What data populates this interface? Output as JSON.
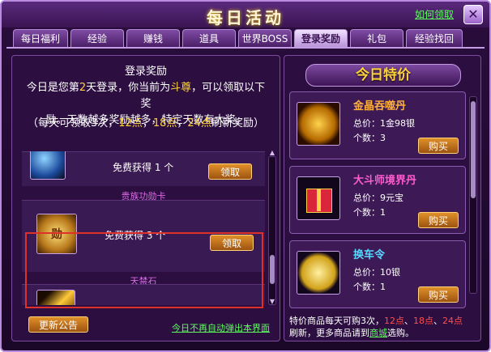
{
  "window": {
    "title": "每日活动",
    "help_link": "如何领取",
    "close_icon": "close-icon"
  },
  "tabs": [
    {
      "label": "每日福利"
    },
    {
      "label": "经验"
    },
    {
      "label": "赚钱"
    },
    {
      "label": "道具"
    },
    {
      "label": "世界BOSS"
    },
    {
      "label": "登录奖励"
    },
    {
      "label": "礼包"
    },
    {
      "label": "经验找回"
    }
  ],
  "active_tab": "登录奖励",
  "login": {
    "heading": "登录奖励",
    "desc_a": "今日是您第",
    "day": "2",
    "desc_b": "天登录，你当前为",
    "rank": "斗尊",
    "desc_c": "，可以领取以下奖",
    "desc_d": "励。天数越多奖励越多，特定天数有大奖。",
    "times_a": "（每天可领取3次，",
    "t1": "12点",
    "sep1": "，",
    "t2": "18点",
    "sep2": "，",
    "t3": "24点",
    "times_b": "刷新奖励）",
    "rewards": [
      {
        "free_text": "免费获得 1 个",
        "button": "领取"
      },
      {
        "section": "贵族功勋卡",
        "free_text": "免费获得 3 个",
        "button": "领取",
        "icon_text": "勋"
      },
      {
        "section": "天禁石"
      }
    ],
    "notice_button": "更新公告",
    "no_popup_link": "今日不再自动弹出本界面"
  },
  "shop": {
    "title": "今日特价",
    "items": [
      {
        "name": "金晶吞噬丹",
        "name_color": "#ffb03b",
        "price_label": "总价：",
        "price": "1金98银",
        "qty_label": "个数：",
        "qty": "3",
        "button": "购买"
      },
      {
        "name": "大斗师境界丹",
        "name_color": "#ff5ccf",
        "price_label": "总价：",
        "price": "9元宝",
        "qty_label": "个数：",
        "qty": "1",
        "button": "购买"
      },
      {
        "name": "换车令",
        "name_color": "#5ad7ff",
        "price_label": "总价：",
        "price": "10银",
        "qty_label": "个数：",
        "qty": "1",
        "button": "购买"
      }
    ],
    "footer_a": "特价商品每天可购3次，",
    "f1": "12点",
    "f2": "18点",
    "f3": "24点",
    "footer_b": "刷新，更多商品请到",
    "shop_link": "商城",
    "footer_c": "选购。"
  }
}
